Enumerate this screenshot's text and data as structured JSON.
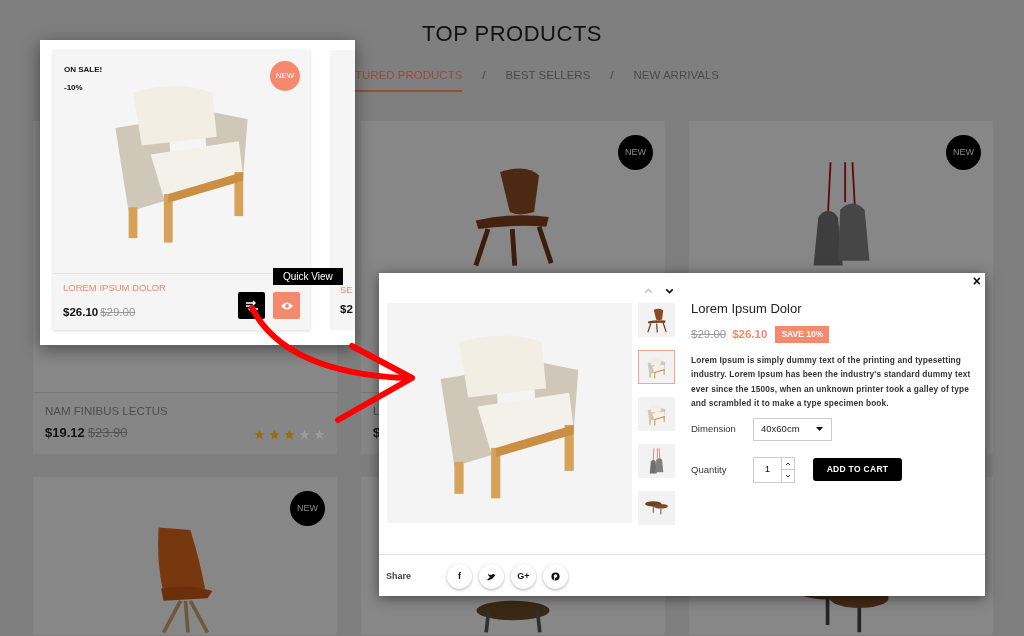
{
  "page": {
    "title": "TOP PRODUCTS",
    "tabs": [
      {
        "label": "TURED PRODUCTS",
        "selected": true
      },
      {
        "label": "BEST SELLERS",
        "selected": false
      },
      {
        "label": "NEW ARRIVALS",
        "selected": false
      }
    ],
    "separators": [
      "/",
      "/"
    ],
    "products": [
      {
        "name": "NAM FINIBUS LECTUS",
        "price": "$19.12",
        "old_price": "$23.90",
        "stars": 3
      },
      {
        "kind": "lounge-chair",
        "badge": "NEW",
        "name": "L",
        "price": "$"
      },
      {
        "kind": "pendant-lamp",
        "badge": "NEW"
      },
      {
        "kind": "side-chair",
        "badge": "NEW"
      },
      {
        "kind": "stool"
      },
      {
        "kind": "round-table"
      }
    ]
  },
  "callout": {
    "card": {
      "labels": [
        "ON SALE!",
        "-10%"
      ],
      "badge": "NEW",
      "kind": "armchair",
      "name": "LOREM IPSUM DOLOR",
      "price": "$26.10",
      "old_price": "$29.00",
      "tooltip": "Quick View"
    },
    "next_card": {
      "name": "SE",
      "price": "$2"
    }
  },
  "modal": {
    "close": "×",
    "scroll_up": {
      "disabled": true
    },
    "scroll_down": {
      "disabled": false
    },
    "thumbnails": [
      {
        "kind": "lounge-chair",
        "selected": false
      },
      {
        "kind": "armchair",
        "selected": true
      },
      {
        "kind": "armchair",
        "selected": false
      },
      {
        "kind": "pendant-lamp",
        "selected": false
      },
      {
        "kind": "round-table",
        "selected": false
      }
    ],
    "title": "Lorem Ipsum Dolor",
    "old_price": "$29.00",
    "price": "$26.10",
    "save": "SAVE 10%",
    "description": "Lorem Ipsum is simply dummy text of the printing and typesetting industry. Lorem Ipsum has been the industry's standard dummy text ever since the 1500s, when an unknown printer took a galley of type and scrambled it to make a type specimen book.",
    "dimension_label": "Dimension",
    "dimension": "40x60cm",
    "quantity_label": "Quantity",
    "quantity": "1",
    "add_to_cart": "ADD TO CART",
    "share_label": "Share",
    "share_buttons": [
      {
        "kind": "letter",
        "label": "f"
      },
      {
        "kind": "bird"
      },
      {
        "kind": "letter",
        "label": "G+"
      },
      {
        "kind": "pin"
      }
    ]
  }
}
